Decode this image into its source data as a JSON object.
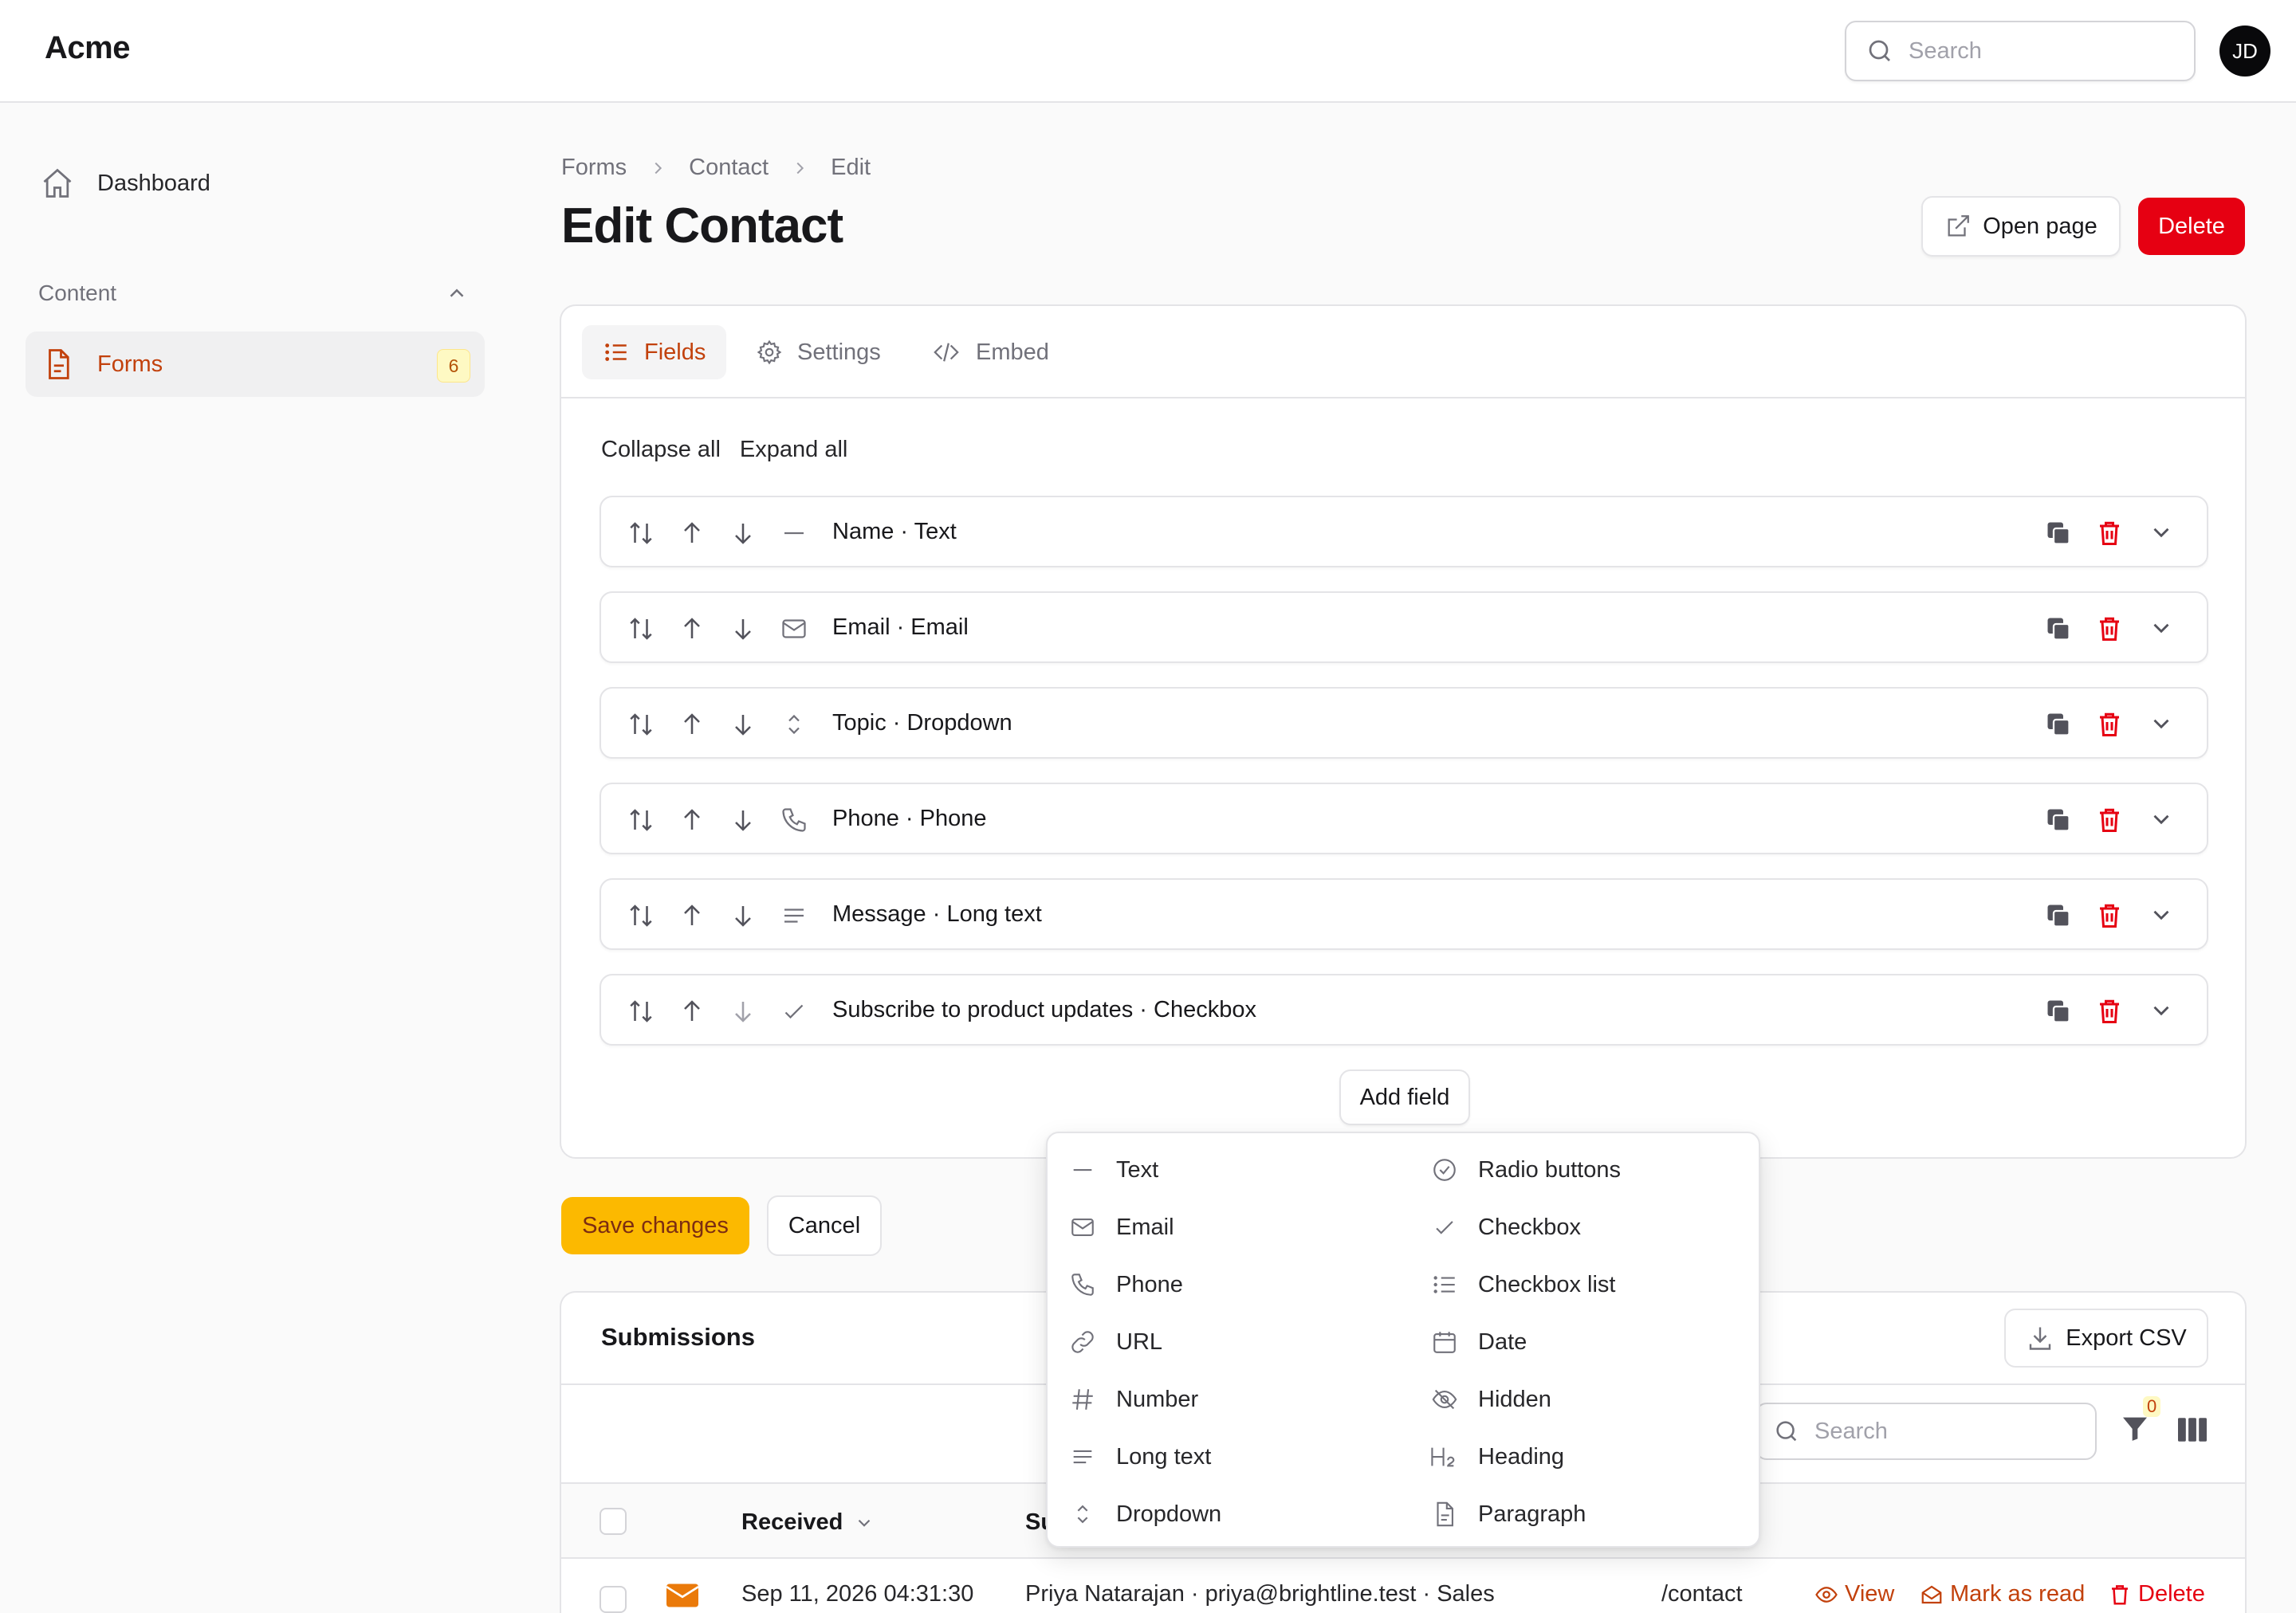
{
  "app": {
    "brand": "Acme",
    "search_placeholder": "Search",
    "avatar_initials": "JD"
  },
  "sidebar": {
    "dashboard": "Dashboard",
    "group": "Content",
    "forms": {
      "label": "Forms",
      "count": "6"
    }
  },
  "breadcrumb": [
    "Forms",
    "Contact",
    "Edit"
  ],
  "page": {
    "title": "Edit Contact",
    "open_page": "Open page",
    "delete": "Delete"
  },
  "tabs": {
    "fields": "Fields",
    "settings": "Settings",
    "embed": "Embed"
  },
  "fields_panel": {
    "collapse_all": "Collapse all",
    "expand_all": "Expand all",
    "rows": [
      {
        "label": "Name · Text",
        "icon": "text-line-icon"
      },
      {
        "label": "Email · Email",
        "icon": "mail-icon"
      },
      {
        "label": "Topic · Dropdown",
        "icon": "chevron-up-down-icon"
      },
      {
        "label": "Phone · Phone",
        "icon": "phone-icon"
      },
      {
        "label": "Message · Long text",
        "icon": "lines-icon"
      },
      {
        "label": "Subscribe to product updates · Checkbox",
        "icon": "check-icon"
      }
    ],
    "add_field": "Add field"
  },
  "actions": {
    "save": "Save changes",
    "cancel": "Cancel"
  },
  "field_types_menu": {
    "left": [
      "Text",
      "Email",
      "Phone",
      "URL",
      "Number",
      "Long text",
      "Dropdown"
    ],
    "right": [
      "Radio buttons",
      "Checkbox",
      "Checkbox list",
      "Date",
      "Hidden",
      "Heading",
      "Paragraph"
    ]
  },
  "submissions": {
    "title": "Submissions",
    "export": "Export CSV",
    "search_placeholder": "Search",
    "filter_count": "0",
    "columns": {
      "received": "Received",
      "subject": "Su"
    },
    "row": {
      "received": "Sep 11, 2026 04:31:30",
      "subject": "Priya Natarajan · priya@brightline.test · Sales",
      "page": "/contact",
      "view": "View",
      "mark_read": "Mark as read",
      "delete": "Delete"
    }
  },
  "colors": {
    "accent": "#c2410c",
    "danger": "#e60012",
    "save": "#fcb900"
  }
}
